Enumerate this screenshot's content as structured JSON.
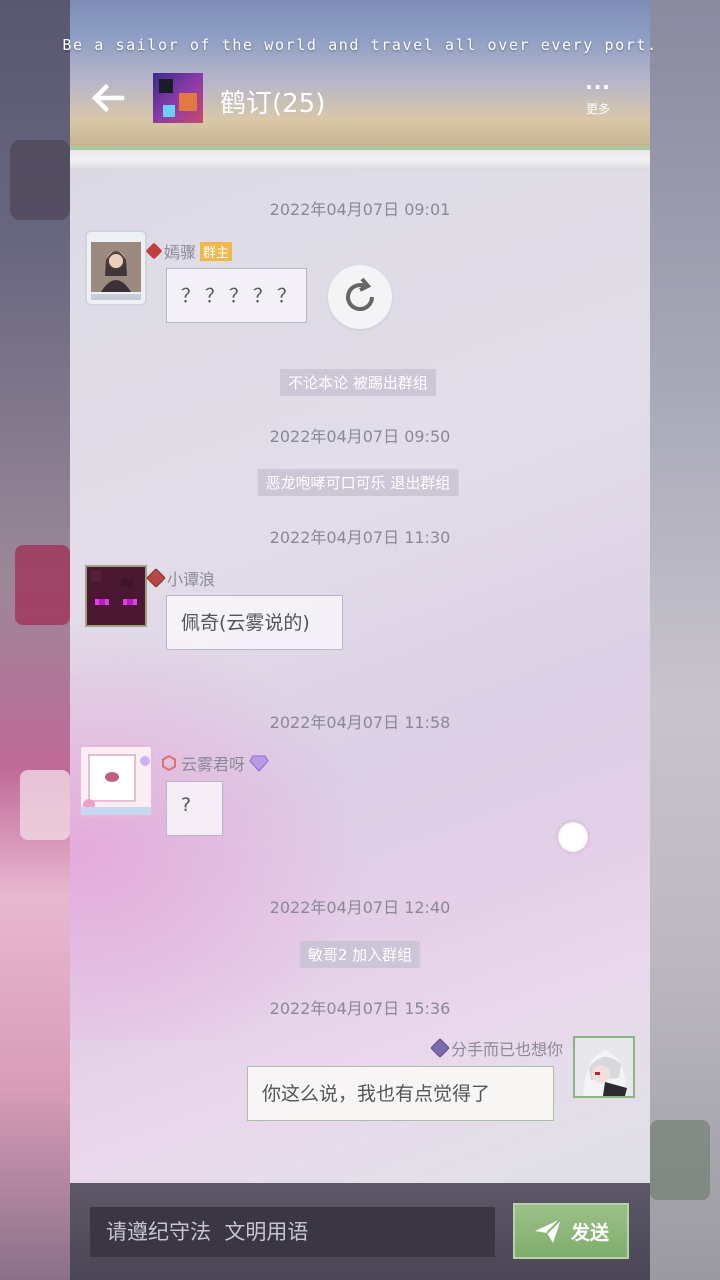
{
  "header": {
    "motto": "Be a sailor of the world and travel all over every port.",
    "group_title": "鹤订(25)",
    "more_label": "更多"
  },
  "messages": {
    "ts1": "2022年04月07日 09:01",
    "m1": {
      "sender": "嫣骤",
      "role_tag": "群主",
      "text": "？？？？？"
    },
    "notice1": "不论本论 被踢出群组",
    "ts2": "2022年04月07日 09:50",
    "notice2": "恶龙咆哮可口可乐 退出群组",
    "ts3": "2022年04月07日 11:30",
    "m2": {
      "sender": "小谭浪",
      "text": "佩奇(云雾说的)"
    },
    "ts4": "2022年04月07日 11:58",
    "m3": {
      "sender": "云雾君呀",
      "text": "?"
    },
    "ts5": "2022年04月07日 12:40",
    "notice3": "敏哥2 加入群组",
    "ts6": "2022年04月07日 15:36",
    "m4": {
      "sender": "分手而已也想你",
      "text": "你这么说，我也有点觉得了"
    }
  },
  "composer": {
    "placeholder": "请遵纪守法  文明用语",
    "send_label": "发送"
  },
  "colors": {
    "accent_green": "#8bb878",
    "owner_tag": "#f0b84a",
    "notice_bg": "#c8c2d4"
  }
}
